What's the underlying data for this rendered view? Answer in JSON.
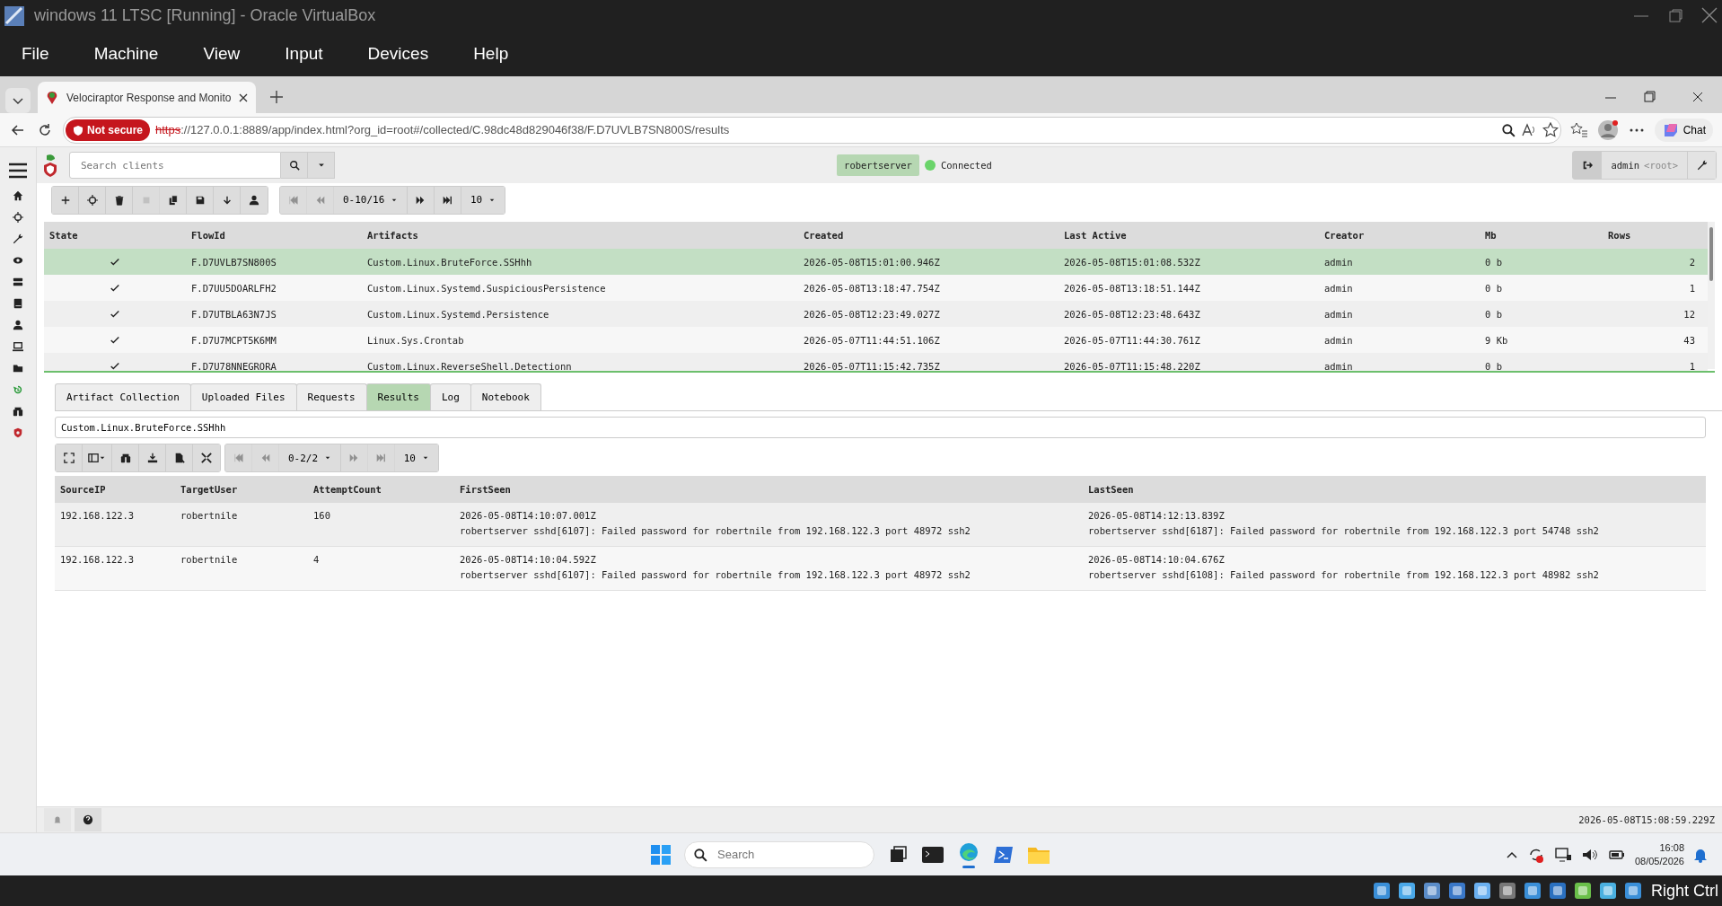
{
  "window": {
    "title": "windows 11 LTSC [Running] - Oracle VirtualBox"
  },
  "menu": [
    "File",
    "Machine",
    "View",
    "Input",
    "Devices",
    "Help"
  ],
  "browser": {
    "tabs": [
      {
        "title": "Velociraptor Response and Monito",
        "selected": true
      }
    ],
    "address": {
      "security": "Not secure",
      "scheme": "https",
      "rest": "://127.0.0.1:8889/app/index.html?org_id=root#/collected/C.98dc48d829046f38/F.D7UVLB7SN800S/results"
    },
    "chat": "Chat"
  },
  "header": {
    "search": {
      "placeholder": "Search clients"
    },
    "client": "robertserver",
    "connection": {
      "label": "Connected",
      "online": true
    },
    "user": {
      "name": "admin",
      "org": "<root>"
    }
  },
  "flows_toolbar": {
    "range": "0-10/16",
    "page_size": "10"
  },
  "flows": {
    "columns": [
      "State",
      "FlowId",
      "Artifacts",
      "Created",
      "Last Active",
      "Creator",
      "Mb",
      "Rows"
    ],
    "rows": [
      {
        "done": true,
        "flow_id": "F.D7UVLB7SN800S",
        "artifacts": "Custom.Linux.BruteForce.SSHhh",
        "created": "2026-05-08T15:01:00.946Z",
        "last_active": "2026-05-08T15:01:08.532Z",
        "creator": "admin",
        "mb": "0 b",
        "rows": "2",
        "selected": true
      },
      {
        "done": true,
        "flow_id": "F.D7UU5DOARLFH2",
        "artifacts": "Custom.Linux.Systemd.SuspiciousPersistence",
        "created": "2026-05-08T13:18:47.754Z",
        "last_active": "2026-05-08T13:18:51.144Z",
        "creator": "admin",
        "mb": "0 b",
        "rows": "1",
        "selected": false
      },
      {
        "done": true,
        "flow_id": "F.D7UTBLA63N7JS",
        "artifacts": "Custom.Linux.Systemd.Persistence",
        "created": "2026-05-08T12:23:49.027Z",
        "last_active": "2026-05-08T12:23:48.643Z",
        "creator": "admin",
        "mb": "0 b",
        "rows": "12",
        "selected": false
      },
      {
        "done": true,
        "flow_id": "F.D7U7MCPT5K6MM",
        "artifacts": "Linux.Sys.Crontab",
        "created": "2026-05-07T11:44:51.106Z",
        "last_active": "2026-05-07T11:44:30.761Z",
        "creator": "admin",
        "mb": "9 Kb",
        "rows": "43",
        "selected": false
      },
      {
        "done": true,
        "flow_id": "F.D7U78NNEGRORA",
        "artifacts": "Custom.Linux.ReverseShell.Detectionn",
        "created": "2026-05-07T11:15:42.735Z",
        "last_active": "2026-05-07T11:15:48.220Z",
        "creator": "admin",
        "mb": "0 b",
        "rows": "1",
        "selected": false
      }
    ]
  },
  "detail_tabs": [
    {
      "label": "Artifact Collection",
      "selected": false
    },
    {
      "label": "Uploaded Files",
      "selected": false
    },
    {
      "label": "Requests",
      "selected": false
    },
    {
      "label": "Results",
      "selected": true
    },
    {
      "label": "Log",
      "selected": false
    },
    {
      "label": "Notebook",
      "selected": false
    }
  ],
  "artifact_field": {
    "value": "Custom.Linux.BruteForce.SSHhh"
  },
  "results_toolbar": {
    "range": "0-2/2",
    "page_size": "10"
  },
  "results": {
    "columns": [
      "SourceIP",
      "TargetUser",
      "AttemptCount",
      "FirstSeen",
      "LastSeen"
    ],
    "rows": [
      {
        "source_ip": "192.168.122.3",
        "target_user": "robertnile",
        "attempt_count": "160",
        "first_seen": [
          "2026-05-08T14:10:07.001Z",
          "robertserver sshd[6107]: Failed password for robertnile from 192.168.122.3 port 48972 ssh2"
        ],
        "last_seen": [
          "2026-05-08T14:12:13.839Z",
          "robertserver sshd[6187]: Failed password for robertnile from 192.168.122.3 port 54748 ssh2"
        ]
      },
      {
        "source_ip": "192.168.122.3",
        "target_user": "robertnile",
        "attempt_count": "4",
        "first_seen": [
          "2026-05-08T14:10:04.592Z",
          "robertserver sshd[6107]: Failed password for robertnile from 192.168.122.3 port 48972 ssh2"
        ],
        "last_seen": [
          "2026-05-08T14:10:04.676Z",
          "robertserver sshd[6108]: Failed password for robertnile from 192.168.122.3 port 48982 ssh2"
        ]
      }
    ]
  },
  "footer": {
    "time": "2026-05-08T15:08:59.229Z"
  },
  "taskbar": {
    "search": {
      "placeholder": "Search"
    },
    "time": "16:08",
    "date": "08/05/2026"
  },
  "vbox_status": {
    "host_key": "Right Ctrl"
  }
}
